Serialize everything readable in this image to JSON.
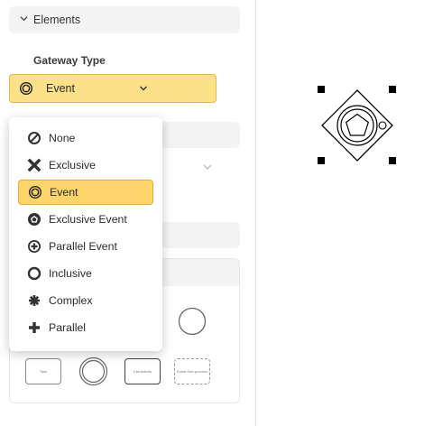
{
  "section": {
    "title": "Elements"
  },
  "gateway_field": {
    "label": "Gateway Type",
    "selected_value": "Event",
    "selected_icon": "event-gateway-icon"
  },
  "menu": {
    "items": [
      {
        "label": "None",
        "icon": "none-icon",
        "selected": false
      },
      {
        "label": "Exclusive",
        "icon": "exclusive-x-icon",
        "selected": false
      },
      {
        "label": "Event",
        "icon": "event-gateway-icon",
        "selected": true
      },
      {
        "label": "Exclusive Event",
        "icon": "exclusive-event-icon",
        "selected": false
      },
      {
        "label": "Parallel Event",
        "icon": "parallel-event-icon",
        "selected": false
      },
      {
        "label": "Inclusive",
        "icon": "inclusive-circle-icon",
        "selected": false
      },
      {
        "label": "Complex",
        "icon": "complex-asterisk-icon",
        "selected": false
      },
      {
        "label": "Parallel",
        "icon": "parallel-plus-icon",
        "selected": false
      }
    ]
  },
  "palette": {
    "items": [
      {
        "label": "Task",
        "icon": "task-shape"
      },
      {
        "label": "",
        "icon": "intermediate-event-shape"
      },
      {
        "label": "Call Activity",
        "icon": "call-activity-shape"
      },
      {
        "label": "Event Sub-process",
        "icon": "event-subprocess-shape"
      }
    ]
  },
  "colors": {
    "accent": "#fde189",
    "accent_border": "#e6b84a",
    "selected_item": "#fdd56b",
    "panel_bg": "#f3f3f3"
  }
}
